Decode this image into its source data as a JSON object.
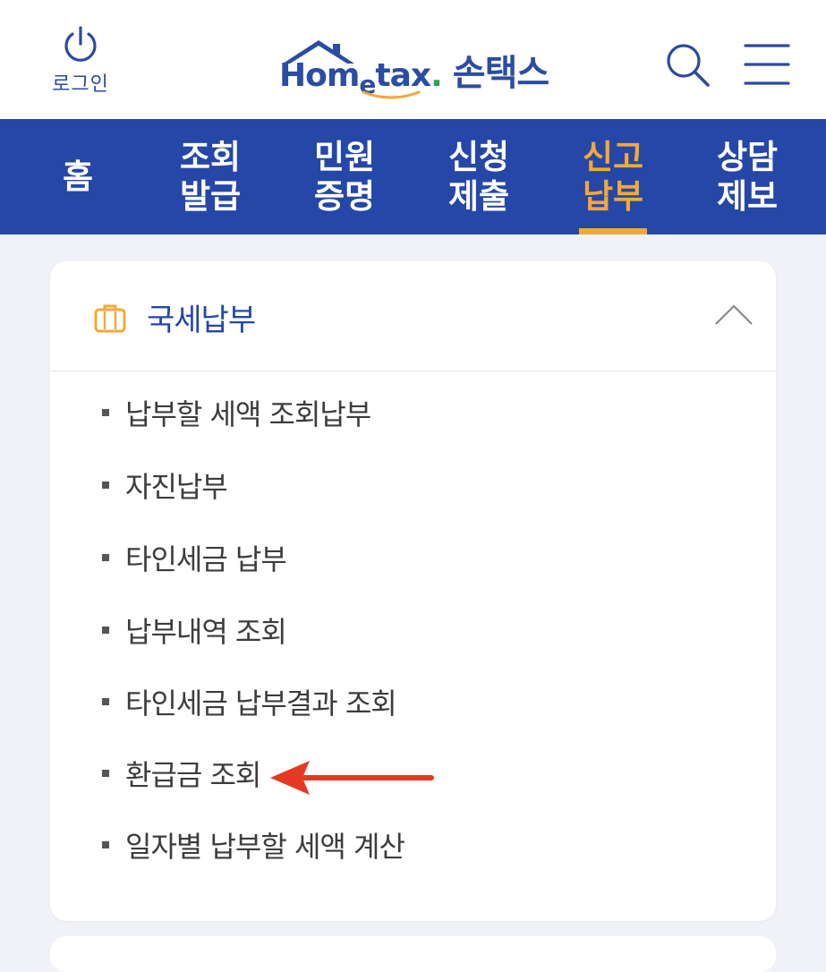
{
  "header": {
    "login_label": "로그인",
    "logo_wordmark_pre": "Hom",
    "logo_wordmark_e": "e",
    "logo_wordmark_post": "tax",
    "logo_wordmark_dot": ".",
    "logo_korean": "손택스",
    "icons": [
      "power-icon",
      "search-icon",
      "hamburger-menu-icon"
    ]
  },
  "nav": {
    "items": [
      {
        "label": "홈"
      },
      {
        "label": "조회\n발급"
      },
      {
        "label": "민원\n증명"
      },
      {
        "label": "신청\n제출"
      },
      {
        "label": "신고\n납부",
        "active": true
      },
      {
        "label": "상담\n제보"
      }
    ]
  },
  "section": {
    "title": "국세납부",
    "icon": "briefcase-icon",
    "expanded": true,
    "items": [
      {
        "label": "납부할 세액 조회납부"
      },
      {
        "label": "자진납부"
      },
      {
        "label": "타인세금 납부"
      },
      {
        "label": "납부내역 조회"
      },
      {
        "label": "타인세금 납부결과 조회"
      },
      {
        "label": "환급금 조회"
      },
      {
        "label": "일자별 납부할 세액 계산"
      }
    ]
  },
  "colors": {
    "brand_blue": "#2547a7",
    "active_orange": "#f2a839",
    "arrow_red": "#e53a22",
    "background": "#f1f2f7"
  }
}
